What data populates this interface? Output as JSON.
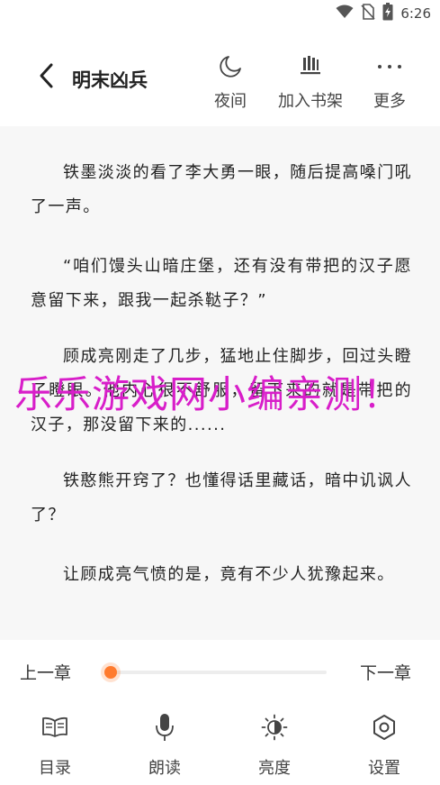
{
  "status_bar": {
    "time": "6:26",
    "icons": [
      "wifi-icon",
      "no-sim-icon",
      "battery-charging-icon"
    ]
  },
  "header": {
    "title": "明末凶兵",
    "back_icon": "chevron-left-icon",
    "actions": [
      {
        "label": "夜间",
        "icon": "moon-icon"
      },
      {
        "label": "加入书架",
        "icon": "bookshelf-icon"
      },
      {
        "label": "更多",
        "icon": "more-dots-icon"
      }
    ]
  },
  "content": {
    "paragraphs": [
      "铁墨淡淡的看了李大勇一眼，随后提高嗓门吼了一声。",
      "“咱们馒头山暗庄堡，还有没有带把的汉子愿意留下来，跟我一起杀鞑子？”",
      "顾成亮刚走了几步，猛地止住脚步，回过头瞪了瞪眼。他内心很不舒服，留下来的就是带把的汉子，那没留下来的......",
      "铁憨熊开窍了？也懂得话里藏话，暗中讥讽人了？",
      "让顾成亮气愤的是，竟有不少人犹豫起来。"
    ]
  },
  "watermark": "乐乐游戏网小编亲测！",
  "chapter_nav": {
    "prev": "上一章",
    "next": "下一章",
    "progress": 0.0
  },
  "toolbar": [
    {
      "label": "目录",
      "icon": "book-catalog-icon"
    },
    {
      "label": "朗读",
      "icon": "microphone-icon"
    },
    {
      "label": "亮度",
      "icon": "brightness-icon"
    },
    {
      "label": "设置",
      "icon": "settings-hexagon-icon"
    }
  ],
  "colors": {
    "accent": "#ff7b2e",
    "watermark": "#d81ec9",
    "reader_bg": "#f7f7f7"
  }
}
